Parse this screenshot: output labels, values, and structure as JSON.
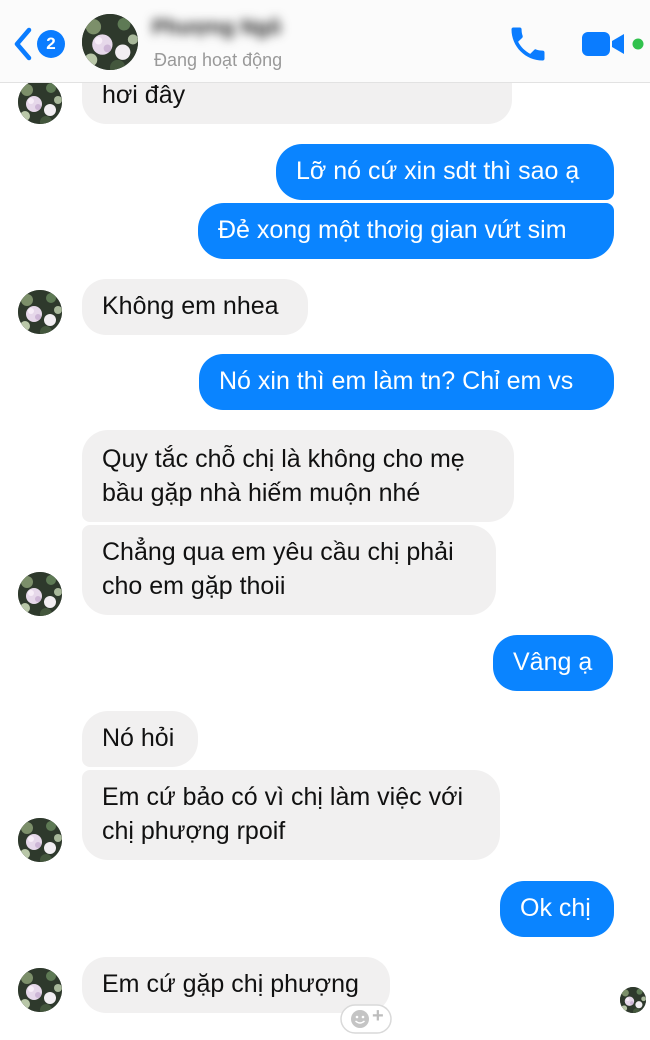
{
  "header": {
    "back_badge_count": "2",
    "contact_name": "Phượng Ngô",
    "status": "Đang hoạt động",
    "icons": [
      "chevron-left-icon",
      "phone-icon",
      "video-camera-icon",
      "online-dot-icon"
    ]
  },
  "colors": {
    "accent": "#0a7cff",
    "outgoing_bubble": "#0a84ff",
    "incoming_bubble": "#f1f0f0",
    "online": "#31c24d"
  },
  "messages": [
    {
      "from": "contact",
      "text": "hơi đây"
    },
    {
      "from": "me",
      "text": "Lỡ nó cứ xin sdt thì sao ạ"
    },
    {
      "from": "me",
      "text": "Đẻ xong một thơig gian vứt sim"
    },
    {
      "from": "contact",
      "text": "Không em nhea"
    },
    {
      "from": "me",
      "text": "Nó xin thì em làm tn? Chỉ em vs"
    },
    {
      "from": "contact",
      "text": "Quy tắc chỗ chị là không cho mẹ\nbầu gặp nhà hiếm muộn nhé"
    },
    {
      "from": "contact",
      "text": "Chẳng qua em yêu cầu chị phải\ncho em gặp thoii"
    },
    {
      "from": "me",
      "text": "Vâng ạ"
    },
    {
      "from": "contact",
      "text": "Nó hỏi"
    },
    {
      "from": "contact",
      "text": "Em cứ bảo có vì chị làm việc với\nchị phượng rpoif"
    },
    {
      "from": "me",
      "text": "Ok chị"
    },
    {
      "from": "contact",
      "text": "Em cứ gặp chị phượng"
    }
  ],
  "reaction_button": {
    "icon": "smiley-plus-icon",
    "label": "+"
  }
}
